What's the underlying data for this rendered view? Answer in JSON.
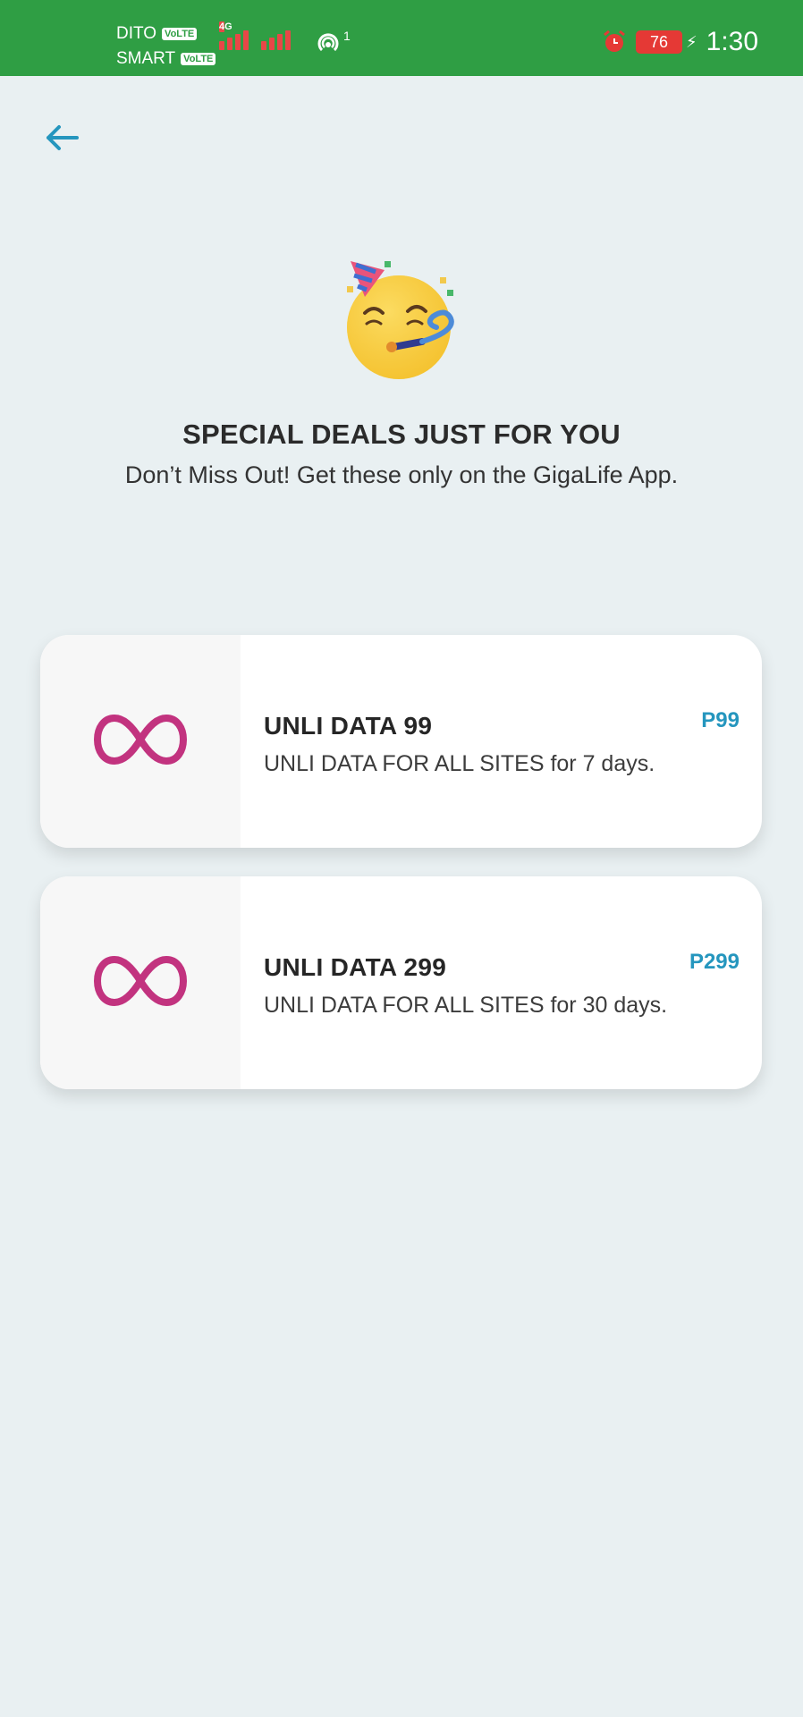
{
  "status_bar": {
    "carrier_1": "DITO",
    "carrier_2": "SMART",
    "volte_label": "VoLTE",
    "network_type": "4G",
    "hotspot_count": "1",
    "battery_level": "76",
    "time": "1:30"
  },
  "header": {
    "back_icon": "arrow-left-icon"
  },
  "hero": {
    "emoji": "party-face-icon",
    "title": "SPECIAL DEALS JUST FOR YOU",
    "subtitle": "Don’t Miss Out! Get these only on the GigaLife App."
  },
  "deals": [
    {
      "icon": "infinity-icon",
      "title": "UNLI DATA 99",
      "description": "UNLI DATA FOR ALL SITES for 7 days.",
      "price": "P99"
    },
    {
      "icon": "infinity-icon",
      "title": "UNLI DATA 299",
      "description": "UNLI DATA FOR ALL SITES for 30 days.",
      "price": "P299"
    }
  ],
  "colors": {
    "status_bar": "#2f9e44",
    "background": "#e9f0f2",
    "accent": "#2596be",
    "infinity": "#c2337f"
  }
}
